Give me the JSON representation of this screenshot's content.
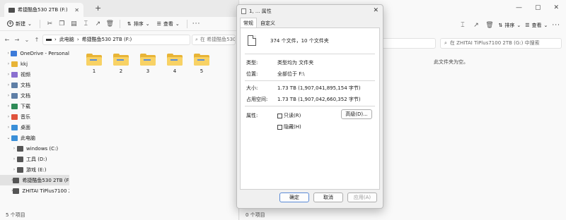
{
  "left_window": {
    "tab_title": "希捷酷鱼530 2TB (F:)",
    "close_glyph": "✕",
    "new_tab_glyph": "+",
    "new_button": "新建",
    "sort_button": "排序",
    "view_button": "查看",
    "more_glyph": "···",
    "breadcrumb_root": "此电脑",
    "breadcrumb_drive": "希捷酷鱼530 2TB (F:)",
    "search_placeholder": "在 希捷酷鱼530",
    "nav_items": [
      {
        "label": "OneDrive - Personal",
        "color": "#3c7bd9",
        "chevron": "›"
      },
      {
        "label": "kkj",
        "color": "#e8b437",
        "chevron": "›"
      },
      {
        "label": "视频",
        "color": "#8a6fd0",
        "chevron": "›"
      },
      {
        "label": "文档",
        "color": "#5f7fa6",
        "chevron": "›"
      },
      {
        "label": "文档",
        "color": "#5f7fa6",
        "chevron": "›"
      },
      {
        "label": "下载",
        "color": "#2e8b57",
        "chevron": "›"
      },
      {
        "label": "音乐",
        "color": "#e0533d",
        "chevron": "›"
      },
      {
        "label": "桌面",
        "color": "#3a8fd8",
        "chevron": "›"
      },
      {
        "label": "此电脑",
        "color": "#3a8fd8",
        "chevron": "⌄"
      },
      {
        "label": "windows (C:)",
        "color": "#555555",
        "chevron": "›"
      },
      {
        "label": "工具 (D:)",
        "color": "#555555",
        "chevron": "›"
      },
      {
        "label": "游戏 (E:)",
        "color": "#555555",
        "chevron": "›"
      },
      {
        "label": "希捷酷鱼530 2TB (F:)",
        "color": "#555555",
        "chevron": "›"
      },
      {
        "label": "ZHITAI TiPlus7100 2T",
        "color": "#555555",
        "chevron": "›"
      }
    ],
    "folders": [
      "1",
      "2",
      "3",
      "4",
      "5"
    ],
    "status": "5 个项目"
  },
  "right_window": {
    "ctrl_minimize": "—",
    "ctrl_maximize": "▢",
    "ctrl_close": "✕",
    "cmd_sort": "排序",
    "cmd_view": "查看",
    "search_placeholder": "在 ZHITAI TiPlus7100 2TB (G:) 中搜索",
    "empty_message": "此文件夹为空。",
    "status": "0 个项目"
  },
  "dialog": {
    "title": "1, ... 属性",
    "tabs": [
      "常规",
      "自定义"
    ],
    "summary": "374 个文件，10 个文件夹",
    "type_label": "类型:",
    "type_value": "类型均为 文件夹",
    "location_label": "位置:",
    "location_value": "全部位于 F:\\",
    "size_label": "大小:",
    "size_value": "1.73 TB (1,907,041,895,154 字节)",
    "disk_label": "占用空间:",
    "disk_value": "1.73 TB (1,907,042,660,352 字节)",
    "attr_label": "属性:",
    "readonly_label": "只读(R)",
    "hidden_label": "隐藏(H)",
    "advanced_button": "高级(D)...",
    "ok_button": "确定",
    "cancel_button": "取消",
    "apply_button": "应用(A)"
  }
}
